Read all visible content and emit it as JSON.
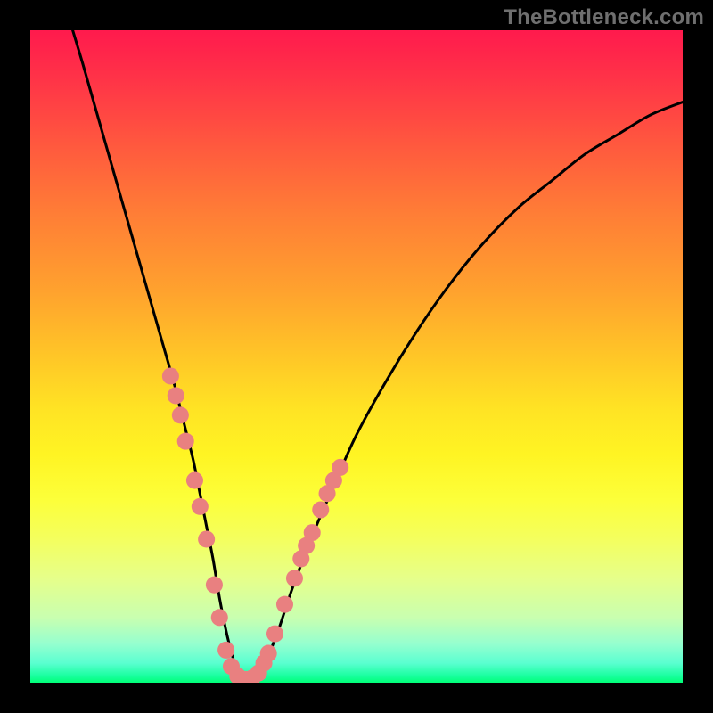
{
  "watermark": "TheBottleneck.com",
  "chart_data": {
    "type": "line",
    "title": "",
    "xlabel": "",
    "ylabel": "",
    "xlim": [
      0,
      100
    ],
    "ylim": [
      0,
      100
    ],
    "series": [
      {
        "name": "curve",
        "color": "#000000",
        "x": [
          6.5,
          8,
          10,
          12,
          14,
          16,
          18,
          20,
          22,
          23,
          24,
          25,
          26,
          27,
          28,
          29,
          30,
          31,
          32,
          33,
          34,
          35,
          36,
          38,
          40,
          43,
          46,
          50,
          55,
          60,
          65,
          70,
          75,
          80,
          85,
          90,
          95,
          100
        ],
        "y": [
          100,
          95,
          88,
          81,
          74,
          67,
          60,
          53,
          46,
          42,
          38,
          34,
          29,
          24,
          19,
          13,
          8,
          4,
          1,
          0,
          0,
          1,
          3,
          8,
          14,
          22,
          29,
          38,
          47,
          55,
          62,
          68,
          73,
          77,
          81,
          84,
          87,
          89
        ]
      }
    ],
    "markers": {
      "name": "dots",
      "color": "#e98080",
      "radius_pct": 1.3,
      "points": [
        {
          "x": 21.5,
          "y": 47
        },
        {
          "x": 22.3,
          "y": 44
        },
        {
          "x": 23.0,
          "y": 41
        },
        {
          "x": 23.8,
          "y": 37
        },
        {
          "x": 25.2,
          "y": 31
        },
        {
          "x": 26.0,
          "y": 27
        },
        {
          "x": 27.0,
          "y": 22
        },
        {
          "x": 28.2,
          "y": 15
        },
        {
          "x": 29.0,
          "y": 10
        },
        {
          "x": 30.0,
          "y": 5
        },
        {
          "x": 30.8,
          "y": 2.5
        },
        {
          "x": 31.8,
          "y": 1
        },
        {
          "x": 33.0,
          "y": 0.5
        },
        {
          "x": 34.0,
          "y": 0.7
        },
        {
          "x": 35.0,
          "y": 1.5
        },
        {
          "x": 35.8,
          "y": 3
        },
        {
          "x": 36.5,
          "y": 4.5
        },
        {
          "x": 37.5,
          "y": 7.5
        },
        {
          "x": 39.0,
          "y": 12
        },
        {
          "x": 40.5,
          "y": 16
        },
        {
          "x": 41.5,
          "y": 19
        },
        {
          "x": 42.3,
          "y": 21
        },
        {
          "x": 43.2,
          "y": 23
        },
        {
          "x": 44.5,
          "y": 26.5
        },
        {
          "x": 45.5,
          "y": 29
        },
        {
          "x": 46.5,
          "y": 31
        },
        {
          "x": 47.5,
          "y": 33
        }
      ]
    },
    "background_gradient": {
      "direction": "vertical",
      "stops": [
        {
          "pos": 0.0,
          "color": "#ff1a4d"
        },
        {
          "pos": 0.5,
          "color": "#ffc627"
        },
        {
          "pos": 0.78,
          "color": "#f4ff5e"
        },
        {
          "pos": 1.0,
          "color": "#00ff77"
        }
      ]
    }
  }
}
